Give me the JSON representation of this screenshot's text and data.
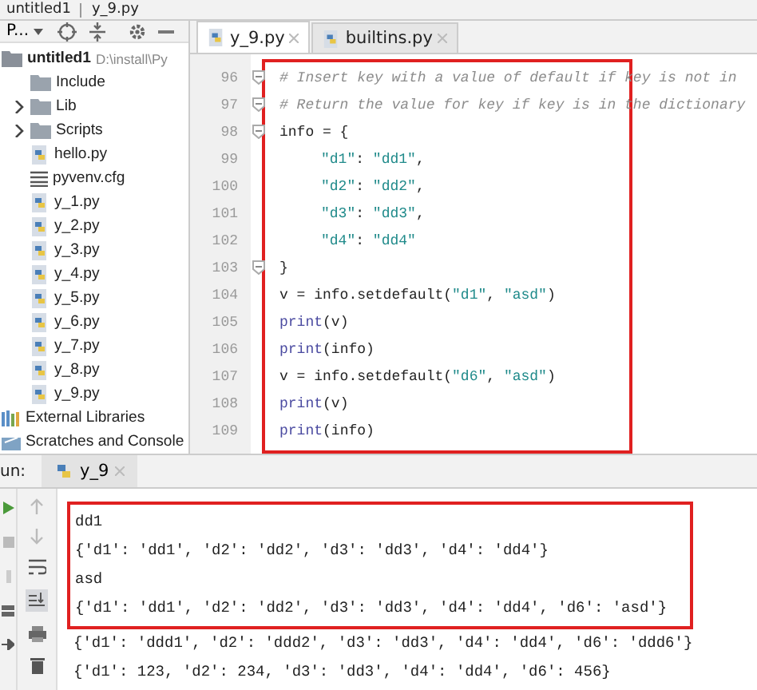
{
  "breadcrumb": [
    "untitled1",
    "y_9.py"
  ],
  "project_panel": {
    "selector": "P...",
    "tree": [
      {
        "label": "untitled1",
        "kind": "folder",
        "path": "D:\\install\\Py",
        "children": [
          {
            "label": "Include",
            "kind": "folder"
          },
          {
            "label": "Lib",
            "kind": "folder",
            "expanded": false
          },
          {
            "label": "Scripts",
            "kind": "folder",
            "expanded": false
          },
          {
            "label": "hello.py",
            "kind": "python"
          },
          {
            "label": "pyvenv.cfg",
            "kind": "config"
          },
          {
            "label": "y_1.py",
            "kind": "python"
          },
          {
            "label": "y_2.py",
            "kind": "python"
          },
          {
            "label": "y_3.py",
            "kind": "python"
          },
          {
            "label": "y_4.py",
            "kind": "python"
          },
          {
            "label": "y_5.py",
            "kind": "python"
          },
          {
            "label": "y_6.py",
            "kind": "python"
          },
          {
            "label": "y_7.py",
            "kind": "python"
          },
          {
            "label": "y_8.py",
            "kind": "python"
          },
          {
            "label": "y_9.py",
            "kind": "python"
          }
        ]
      },
      {
        "label": "External Libraries",
        "kind": "libraries"
      },
      {
        "label": "Scratches and Console",
        "kind": "scratches"
      }
    ]
  },
  "editor_tabs": [
    {
      "label": "y_9.py",
      "selected": true
    },
    {
      "label": "builtins.py",
      "selected": false
    }
  ],
  "code_blocks": [
    {
      "highlighted": true,
      "lines": [
        {
          "number": "96",
          "fold": true,
          "indented": false,
          "tokens": [
            {
              "text": "# Insert key with a value of default if key is not in",
              "kind": "comment"
            }
          ]
        },
        {
          "number": "97",
          "fold": true,
          "indented": false,
          "tokens": [
            {
              "text": "# Return the value for key if key is in the dictionary",
              "kind": "comment"
            }
          ]
        },
        {
          "number": "98",
          "fold": true,
          "indented": false,
          "tokens": [
            {
              "text": "info = {",
              "kind": "plain"
            }
          ]
        },
        {
          "number": "99",
          "fold": false,
          "indented": true,
          "tokens": [
            {
              "text": "\"d1\"",
              "kind": "string"
            },
            {
              "text": ": ",
              "kind": "plain"
            },
            {
              "text": "\"dd1\"",
              "kind": "string"
            },
            {
              "text": ",",
              "kind": "plain"
            }
          ]
        },
        {
          "number": "100",
          "fold": false,
          "indented": true,
          "tokens": [
            {
              "text": "\"d2\"",
              "kind": "string"
            },
            {
              "text": ": ",
              "kind": "plain"
            },
            {
              "text": "\"dd2\"",
              "kind": "string"
            },
            {
              "text": ",",
              "kind": "plain"
            }
          ]
        },
        {
          "number": "101",
          "fold": false,
          "indented": true,
          "tokens": [
            {
              "text": "\"d3\"",
              "kind": "string"
            },
            {
              "text": ": ",
              "kind": "plain"
            },
            {
              "text": "\"dd3\"",
              "kind": "string"
            },
            {
              "text": ",",
              "kind": "plain"
            }
          ]
        },
        {
          "number": "102",
          "fold": false,
          "indented": true,
          "tokens": [
            {
              "text": "\"d4\"",
              "kind": "string"
            },
            {
              "text": ": ",
              "kind": "plain"
            },
            {
              "text": "\"dd4\"",
              "kind": "string"
            }
          ]
        },
        {
          "number": "103",
          "fold": true,
          "indented": false,
          "tokens": [
            {
              "text": "}",
              "kind": "plain"
            }
          ]
        },
        {
          "number": "104",
          "fold": false,
          "indented": false,
          "tokens": [
            {
              "text": "v = info.setdefault(",
              "kind": "plain"
            },
            {
              "text": "\"d1\"",
              "kind": "string"
            },
            {
              "text": ", ",
              "kind": "plain"
            },
            {
              "text": "\"asd\"",
              "kind": "string"
            },
            {
              "text": ")",
              "kind": "plain"
            }
          ]
        },
        {
          "number": "105",
          "fold": false,
          "indented": false,
          "tokens": [
            {
              "text": "print",
              "kind": "builtin"
            },
            {
              "text": "(v)",
              "kind": "plain"
            }
          ]
        },
        {
          "number": "106",
          "fold": false,
          "indented": false,
          "tokens": [
            {
              "text": "print",
              "kind": "builtin"
            },
            {
              "text": "(info)",
              "kind": "plain"
            }
          ]
        },
        {
          "number": "107",
          "fold": false,
          "indented": false,
          "tokens": [
            {
              "text": "v = info.setdefault(",
              "kind": "plain"
            },
            {
              "text": "\"d6\"",
              "kind": "string"
            },
            {
              "text": ", ",
              "kind": "plain"
            },
            {
              "text": "\"asd\"",
              "kind": "string"
            },
            {
              "text": ")",
              "kind": "plain"
            }
          ]
        },
        {
          "number": "108",
          "fold": false,
          "indented": false,
          "tokens": [
            {
              "text": "print",
              "kind": "builtin"
            },
            {
              "text": "(v)",
              "kind": "plain"
            }
          ]
        },
        {
          "number": "109",
          "fold": false,
          "indented": false,
          "tokens": [
            {
              "text": "print",
              "kind": "builtin"
            },
            {
              "text": "(info)",
              "kind": "plain"
            }
          ]
        }
      ]
    }
  ],
  "run_panel": {
    "label": "un:",
    "tab": "y_9",
    "output_blocks": [
      {
        "highlighted": true,
        "lines": [
          "dd1",
          "{'d1': 'dd1', 'd2': 'dd2', 'd3': 'dd3', 'd4': 'dd4'}",
          "asd",
          "{'d1': 'dd1', 'd2': 'dd2', 'd3': 'dd3', 'd4': 'dd4', 'd6': 'asd'}"
        ]
      },
      {
        "highlighted": false,
        "lines": [
          "{'d1': 'ddd1', 'd2': 'ddd2', 'd3': 'dd3', 'd4': 'dd4', 'd6': 'ddd6'}",
          "{'d1': 123, 'd2': 234, 'd3': 'dd3', 'd4': 'dd4', 'd6': 456}"
        ]
      }
    ]
  }
}
